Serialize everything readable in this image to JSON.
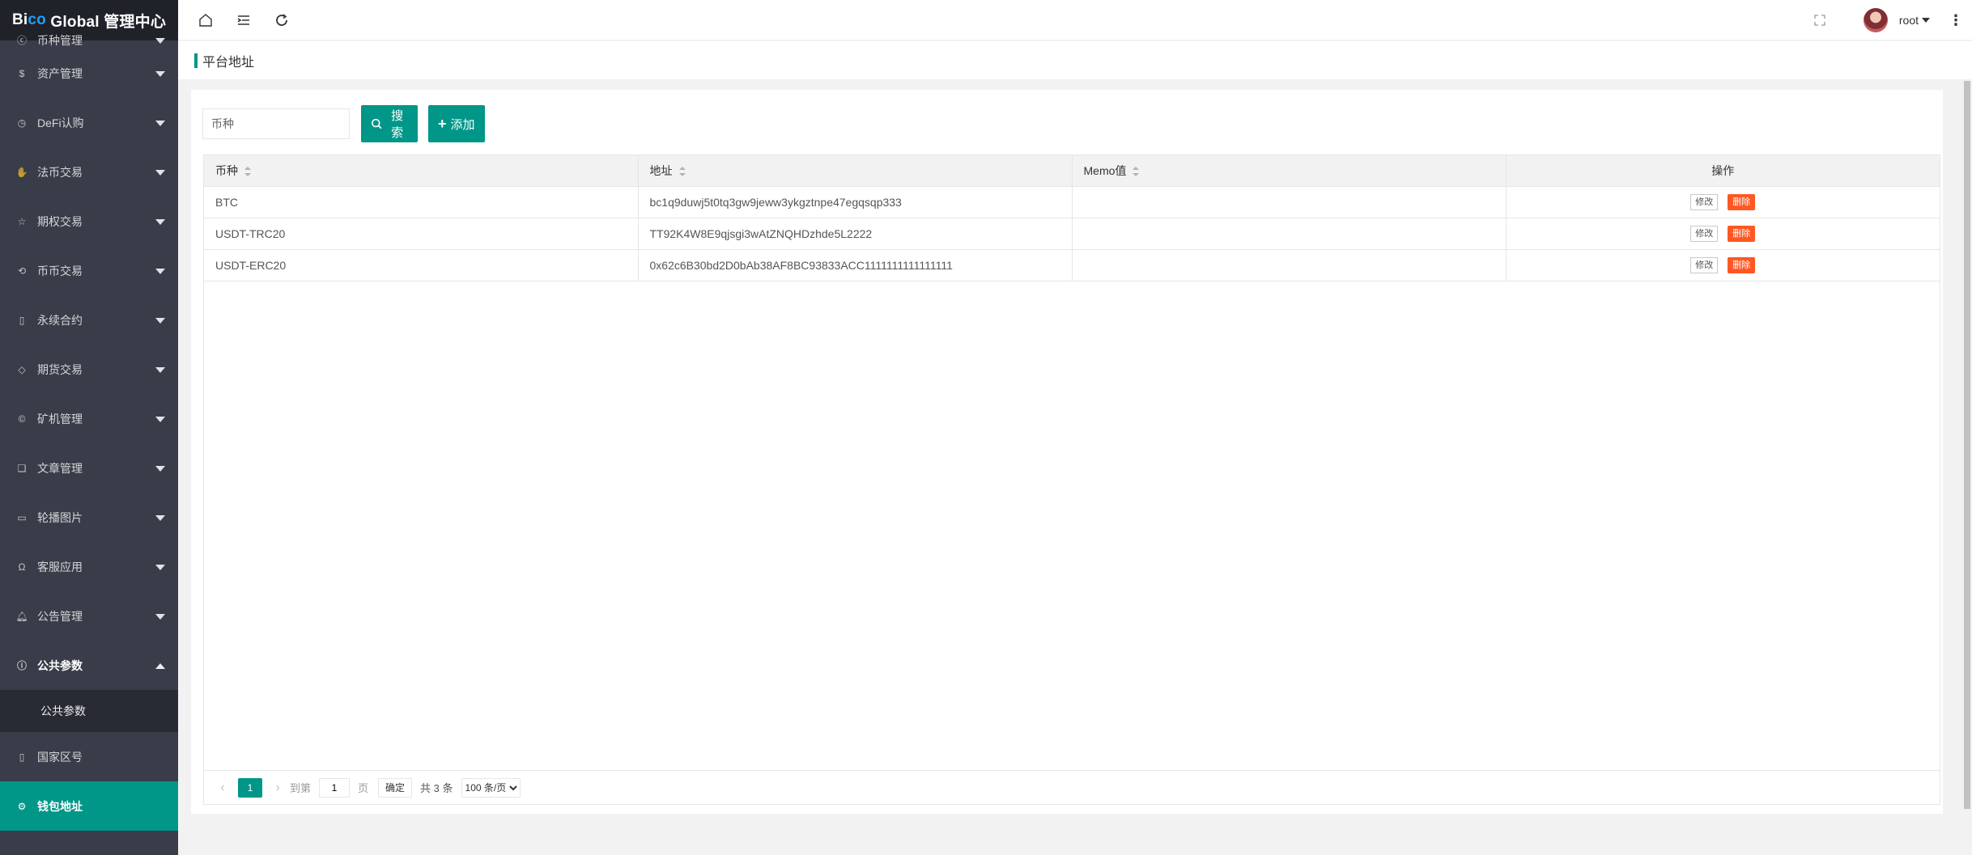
{
  "app": {
    "logo_prefix": "Bi",
    "logo_accent": "co",
    "logo_suffix": " Global 管理中心"
  },
  "sidebar": {
    "items": [
      {
        "label": "币种管理",
        "icon": "coin-icon"
      },
      {
        "label": "资产管理",
        "icon": "dollar-icon"
      },
      {
        "label": "DeFi认购",
        "icon": "clock-icon"
      },
      {
        "label": "法币交易",
        "icon": "hand-icon"
      },
      {
        "label": "期权交易",
        "icon": "star-icon"
      },
      {
        "label": "币币交易",
        "icon": "cycle-icon"
      },
      {
        "label": "永续合约",
        "icon": "document-icon"
      },
      {
        "label": "期货交易",
        "icon": "diamond-icon"
      },
      {
        "label": "矿机管理",
        "icon": "copyright-icon"
      },
      {
        "label": "文章管理",
        "icon": "book-icon"
      },
      {
        "label": "轮播图片",
        "icon": "image-icon"
      },
      {
        "label": "客服应用",
        "icon": "headset-icon"
      },
      {
        "label": "公告管理",
        "icon": "bell-icon"
      },
      {
        "label": "公共参数",
        "icon": "info-icon"
      }
    ],
    "submenu": [
      "公共参数"
    ],
    "after": [
      {
        "label": "国家区号",
        "icon": "phone-icon"
      },
      {
        "label": "钱包地址",
        "icon": "gear-icon"
      }
    ]
  },
  "header": {
    "user": "root"
  },
  "breadcrumb": {
    "title": "平台地址"
  },
  "toolbar": {
    "search_placeholder": "币种",
    "search_label": "搜索",
    "add_label": "添加"
  },
  "table": {
    "columns": [
      "币种",
      "地址",
      "Memo值",
      "操作"
    ],
    "rows": [
      {
        "coin": "BTC",
        "address": "bc1q9duwj5t0tq3gw9jeww3ykgztnpe47egqsqp333",
        "memo": ""
      },
      {
        "coin": "USDT-TRC20",
        "address": "TT92K4W8E9qjsgi3wAtZNQHDzhde5L2222",
        "memo": ""
      },
      {
        "coin": "USDT-ERC20",
        "address": "0x62c6B30bd2D0bAb38AF8BC93833ACC1111111111111111",
        "memo": ""
      }
    ],
    "edit_label": "修改",
    "delete_label": "删除"
  },
  "pager": {
    "current": "1",
    "goto_label": "到第",
    "page_value": "1",
    "page_unit": "页",
    "confirm_label": "确定",
    "total": "共 3 条",
    "page_size": "100 条/页"
  },
  "colors": {
    "primary": "#009688",
    "danger": "#ff5722",
    "sidebar_bg": "#393d49",
    "logo_bg": "#20222a"
  }
}
